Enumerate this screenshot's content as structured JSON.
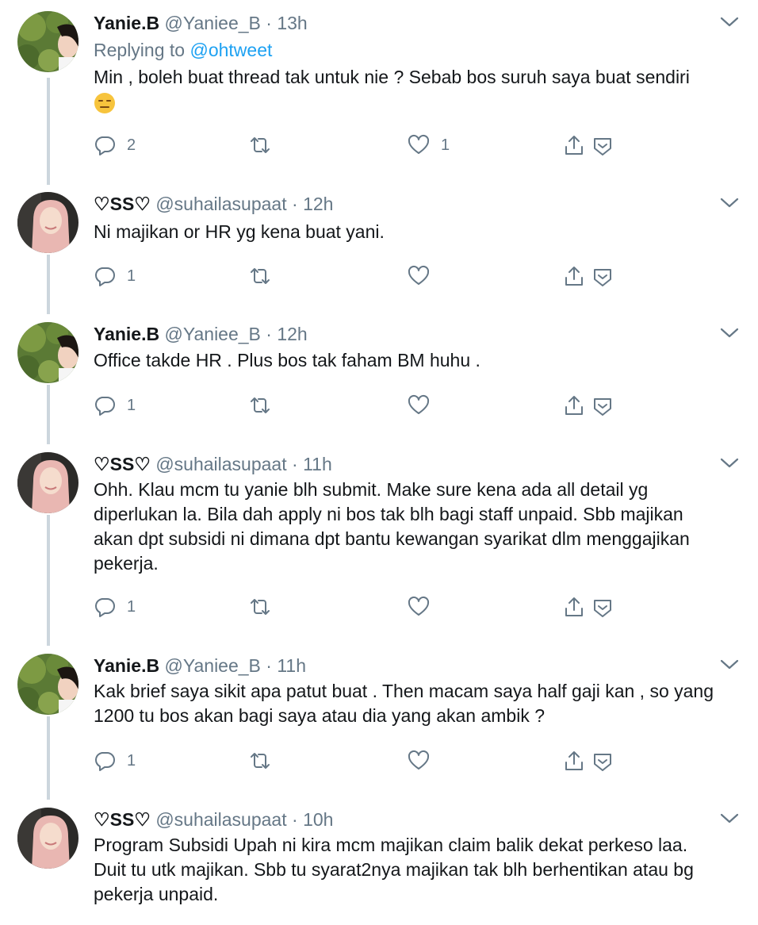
{
  "tweets": [
    {
      "name": "Yanie.B",
      "handle": "@Yaniee_B",
      "dot": "·",
      "time": "13h",
      "replying_label": "Replying to",
      "replying_to": "@ohtweet",
      "text_lines": [
        "Min , boleh buat thread tak untuk nie ? Sebab bos suruh saya buat sendiri"
      ],
      "emoji": "expressionless-face-emoji",
      "reply_count": "2",
      "retweet_count": "",
      "like_count": "1"
    },
    {
      "name": "♡SS♡",
      "handle": "@suhailasupaat",
      "dot": "·",
      "time": "12h",
      "text_lines": [
        "Ni majikan or HR yg kena buat yani."
      ],
      "reply_count": "1",
      "retweet_count": "",
      "like_count": ""
    },
    {
      "name": "Yanie.B",
      "handle": "@Yaniee_B",
      "dot": "·",
      "time": "12h",
      "text_lines": [
        "Office takde HR . Plus bos tak faham BM huhu ."
      ],
      "reply_count": "1",
      "retweet_count": "",
      "like_count": ""
    },
    {
      "name": "♡SS♡",
      "handle": "@suhailasupaat",
      "dot": "·",
      "time": "11h",
      "text_lines": [
        "Ohh. Klau mcm tu yanie blh submit. Make sure kena ada all detail yg",
        "diperlukan la. Bila dah apply ni bos tak blh bagi staff unpaid. Sbb majikan",
        "akan dpt subsidi ni dimana dpt bantu kewangan syarikat dlm menggajikan",
        "pekerja."
      ],
      "reply_count": "1",
      "retweet_count": "",
      "like_count": ""
    },
    {
      "name": "Yanie.B",
      "handle": "@Yaniee_B",
      "dot": "·",
      "time": "11h",
      "text_lines": [
        "Kak brief saya sikit apa patut buat . Then macam saya half gaji kan , so yang",
        "1200 tu bos akan bagi saya atau dia yang akan ambik ?"
      ],
      "reply_count": "1",
      "retweet_count": "",
      "like_count": ""
    },
    {
      "name": "♡SS♡",
      "handle": "@suhailasupaat",
      "dot": "·",
      "time": "10h",
      "text_lines": [
        "Program Subsidi Upah ni kira mcm majikan claim balik dekat perkeso laa.",
        "Duit tu utk majikan. Sbb tu syarat2nya majikan tak blh berhentikan atau bg",
        "pekerja unpaid."
      ]
    }
  ],
  "icons": {
    "reply": "reply-icon",
    "retweet": "retweet-icon",
    "like": "heart-icon",
    "share": "share-icon",
    "dm": "direct-message-icon",
    "more": "chevron-down-icon"
  },
  "colors": {
    "text": "#14171a",
    "muted": "#657786",
    "link": "#1da1f2",
    "thread_line": "#ccd6dd",
    "emoji": "#f7c43d"
  }
}
